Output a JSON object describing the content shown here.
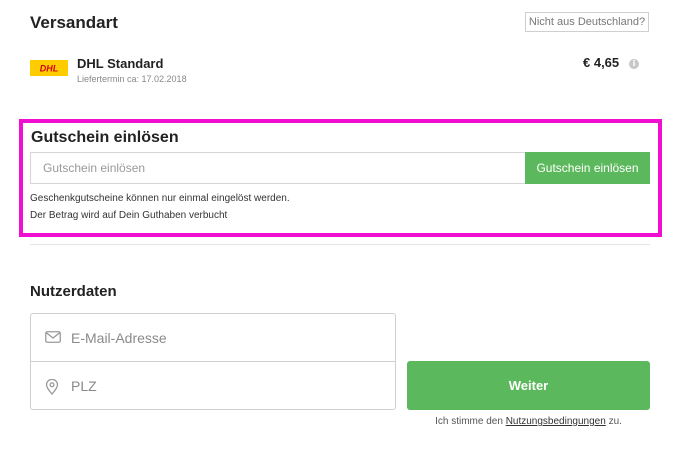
{
  "shipping": {
    "title": "Versandart",
    "not_germany_link": "Nicht aus Deutschland?",
    "method": {
      "logo_text": "DHL",
      "name": "DHL Standard",
      "delivery": "Liefertermin ca: 17.02.2018",
      "price": "€ 4,65",
      "info_icon": "i"
    }
  },
  "voucher": {
    "title": "Gutschein einlösen",
    "input_placeholder": "Gutschein einlösen",
    "button_label": "Gutschein einlösen",
    "note_1": "Geschenkgutscheine können nur einmal eingelöst werden.",
    "note_2": "Der Betrag wird auf Dein Guthaben verbucht",
    "highlight_color": "#f00fd0"
  },
  "user": {
    "title": "Nutzerdaten",
    "email_placeholder": "E-Mail-Adresse",
    "zip_placeholder": "PLZ",
    "continue_label": "Weiter",
    "terms_prefix": "Ich stimme den",
    "terms_link": "Nutzungsbedingungen",
    "terms_suffix": "zu."
  },
  "icons": {
    "email": "envelope-icon",
    "zip": "location-pin-icon",
    "info": "info-icon",
    "logo": "dhl-logo"
  },
  "colors": {
    "accent": "#5cb85c",
    "dhl_yellow": "#ffcc00",
    "dhl_red": "#d40511"
  }
}
